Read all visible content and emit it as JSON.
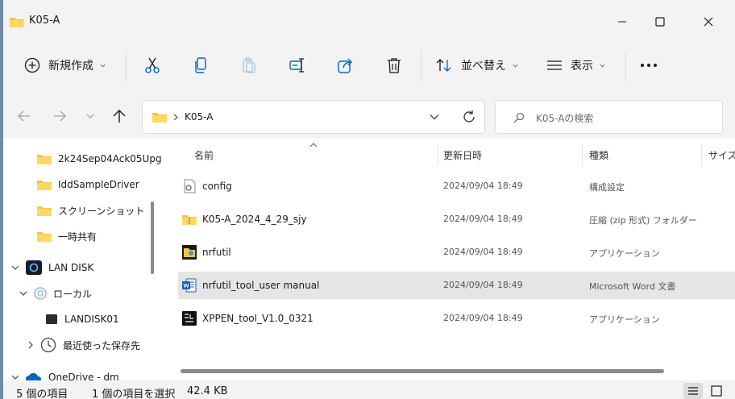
{
  "window": {
    "title": "K05-A"
  },
  "ribbon": {
    "new_label": "新規作成",
    "sort_label": "並べ替え",
    "view_label": "表示"
  },
  "address": {
    "path": "K05-A"
  },
  "search": {
    "placeholder": "K05-Aの検索"
  },
  "sidebar": {
    "items": [
      {
        "label": "2k24Sep04Ack05Upg"
      },
      {
        "label": "IddSampleDriver"
      },
      {
        "label": "スクリーンショット"
      },
      {
        "label": "一時共有"
      },
      {
        "label": "LAN DISK"
      },
      {
        "label": "ローカル"
      },
      {
        "label": "LANDISK01"
      },
      {
        "label": "最近使った保存先"
      },
      {
        "label": "OneDrive - dm"
      }
    ]
  },
  "columns": {
    "name": "名前",
    "modified": "更新日時",
    "type": "種類",
    "size": "サイズ"
  },
  "files": [
    {
      "name": "config",
      "modified": "2024/09/04 18:49",
      "type": "構成設定",
      "icon": "config-file-icon"
    },
    {
      "name": "K05-A_2024_4_29_sjy",
      "modified": "2024/09/04 18:49",
      "type": "圧縮 (zip 形式) フォルダー",
      "icon": "zip-folder-icon"
    },
    {
      "name": "nrfutil",
      "modified": "2024/09/04 18:49",
      "type": "アプリケーション",
      "icon": "app-icon"
    },
    {
      "name": "nrfutil_tool_user manual",
      "modified": "2024/09/04 18:49",
      "type": "Microsoft Word 文書",
      "icon": "word-icon"
    },
    {
      "name": "XPPEN_tool_V1.0_0321",
      "modified": "2024/09/04 18:49",
      "type": "アプリケーション",
      "icon": "xppen-icon"
    }
  ],
  "status": {
    "item_count": "5 個の項目",
    "selection": "1 個の項目を選択",
    "size": "42.4 KB"
  },
  "colors": {
    "folder": "#f4c542",
    "accent": "#0067c0",
    "selected_row": "#e5e5e5"
  }
}
